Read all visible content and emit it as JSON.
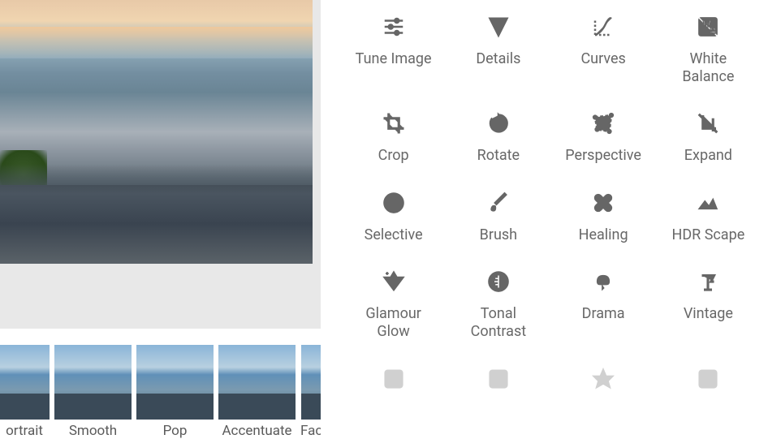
{
  "filters": [
    {
      "label": "ortrait"
    },
    {
      "label": "Smooth"
    },
    {
      "label": "Pop"
    },
    {
      "label": "Accentuate"
    },
    {
      "label": "Fac"
    }
  ],
  "tools": {
    "row1": [
      {
        "name": "tune-image",
        "label": "Tune Image"
      },
      {
        "name": "details",
        "label": "Details"
      },
      {
        "name": "curves",
        "label": "Curves"
      },
      {
        "name": "white-balance",
        "label": "White\nBalance"
      }
    ],
    "row2": [
      {
        "name": "crop",
        "label": "Crop"
      },
      {
        "name": "rotate",
        "label": "Rotate"
      },
      {
        "name": "perspective",
        "label": "Perspective"
      },
      {
        "name": "expand",
        "label": "Expand"
      }
    ],
    "row3": [
      {
        "name": "selective",
        "label": "Selective"
      },
      {
        "name": "brush",
        "label": "Brush"
      },
      {
        "name": "healing",
        "label": "Healing"
      },
      {
        "name": "hdr-scape",
        "label": "HDR Scape"
      }
    ],
    "row4": [
      {
        "name": "glamour-glow",
        "label": "Glamour\nGlow"
      },
      {
        "name": "tonal-contrast",
        "label": "Tonal\nContrast"
      },
      {
        "name": "drama",
        "label": "Drama"
      },
      {
        "name": "vintage",
        "label": "Vintage"
      }
    ]
  }
}
